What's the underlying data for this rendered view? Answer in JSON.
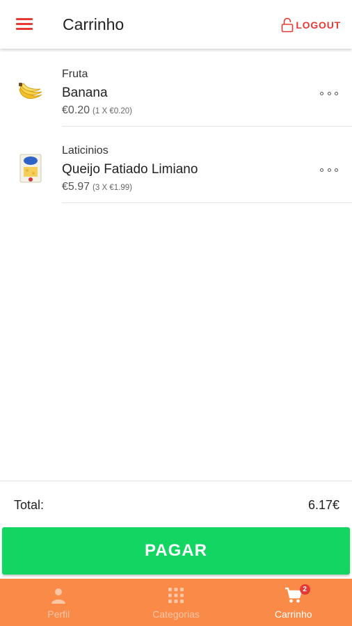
{
  "header": {
    "title": "Carrinho",
    "logout_label": "LOGOUT"
  },
  "cart": {
    "items": [
      {
        "category": "Fruta",
        "name": "Banana",
        "price": "€0.20",
        "detail": "(1 X €0.20)",
        "icon": "banana-icon"
      },
      {
        "category": "Laticinios",
        "name": "Queijo Fatiado Limiano",
        "price": "€5.97",
        "detail": "(3 X €1.99)",
        "icon": "cheese-package-icon"
      }
    ]
  },
  "summary": {
    "total_label": "Total:",
    "total_value": "6.17€"
  },
  "pay_button": {
    "label": "PAGAR"
  },
  "bottom_nav": {
    "items": [
      {
        "label": "Perfil",
        "icon": "person-icon",
        "active": false
      },
      {
        "label": "Categorias",
        "icon": "grid-icon",
        "active": false
      },
      {
        "label": "Carrinho",
        "icon": "cart-icon",
        "active": true,
        "badge": "2"
      }
    ]
  },
  "colors": {
    "accent": "#e53935",
    "pay": "#13d662",
    "nav": "#fa8a48"
  }
}
